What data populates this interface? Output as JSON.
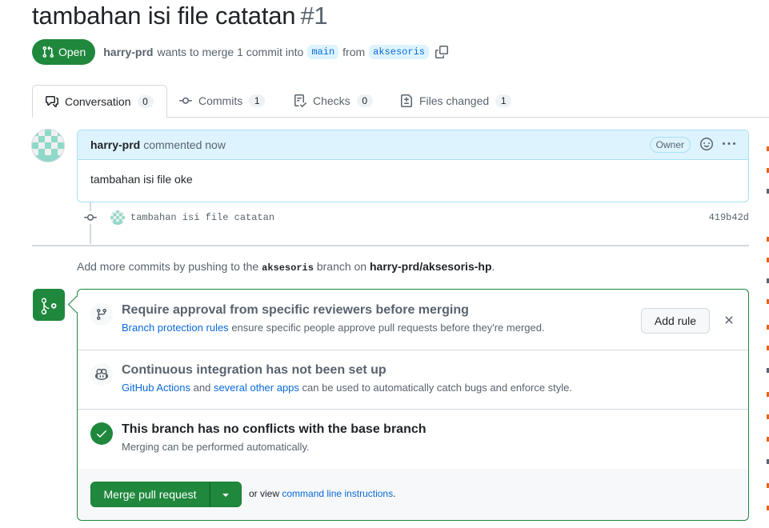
{
  "pr": {
    "title": "tambahan isi file catatan",
    "number": "#1",
    "state": "Open",
    "author": "harry-prd",
    "merge_text": "wants to merge 1 commit into",
    "base_branch": "main",
    "from_text": "from",
    "head_branch": "aksesoris"
  },
  "tabs": [
    {
      "label": "Conversation",
      "count": "0",
      "icon": "comment-discussion-icon"
    },
    {
      "label": "Commits",
      "count": "1",
      "icon": "git-commit-icon"
    },
    {
      "label": "Checks",
      "count": "0",
      "icon": "checklist-icon"
    },
    {
      "label": "Files changed",
      "count": "1",
      "icon": "file-diff-icon"
    }
  ],
  "comment": {
    "author": "harry-prd",
    "time": "commented now",
    "badge": "Owner",
    "body": "tambahan isi file oke"
  },
  "commit": {
    "message": "tambahan isi file catatan",
    "sha": "419b42d"
  },
  "push_hint": {
    "prefix": "Add more commits by pushing to the",
    "branch": "aksesoris",
    "middle": "branch on",
    "repo": "harry-prd/aksesoris-hp",
    "suffix": "."
  },
  "merge_box": {
    "rule": {
      "title": "Require approval from specific reviewers before merging",
      "link": "Branch protection rules",
      "desc": "ensure specific people approve pull requests before they're merged.",
      "button": "Add rule"
    },
    "ci": {
      "title": "Continuous integration has not been set up",
      "link1": "GitHub Actions",
      "and": "and",
      "link2": "several other apps",
      "desc": "can be used to automatically catch bugs and enforce style."
    },
    "conflicts": {
      "title": "This branch has no conflicts with the base branch",
      "desc": "Merging can be performed automatically."
    },
    "footer": {
      "merge_button": "Merge pull request",
      "or_view": "or view",
      "cli_link": "command line instructions",
      "period": "."
    }
  },
  "colors": {
    "green": "#1f883d",
    "link": "#0969da",
    "comment_header": "#ddf4ff",
    "edge_fragment": "#e0661e"
  }
}
